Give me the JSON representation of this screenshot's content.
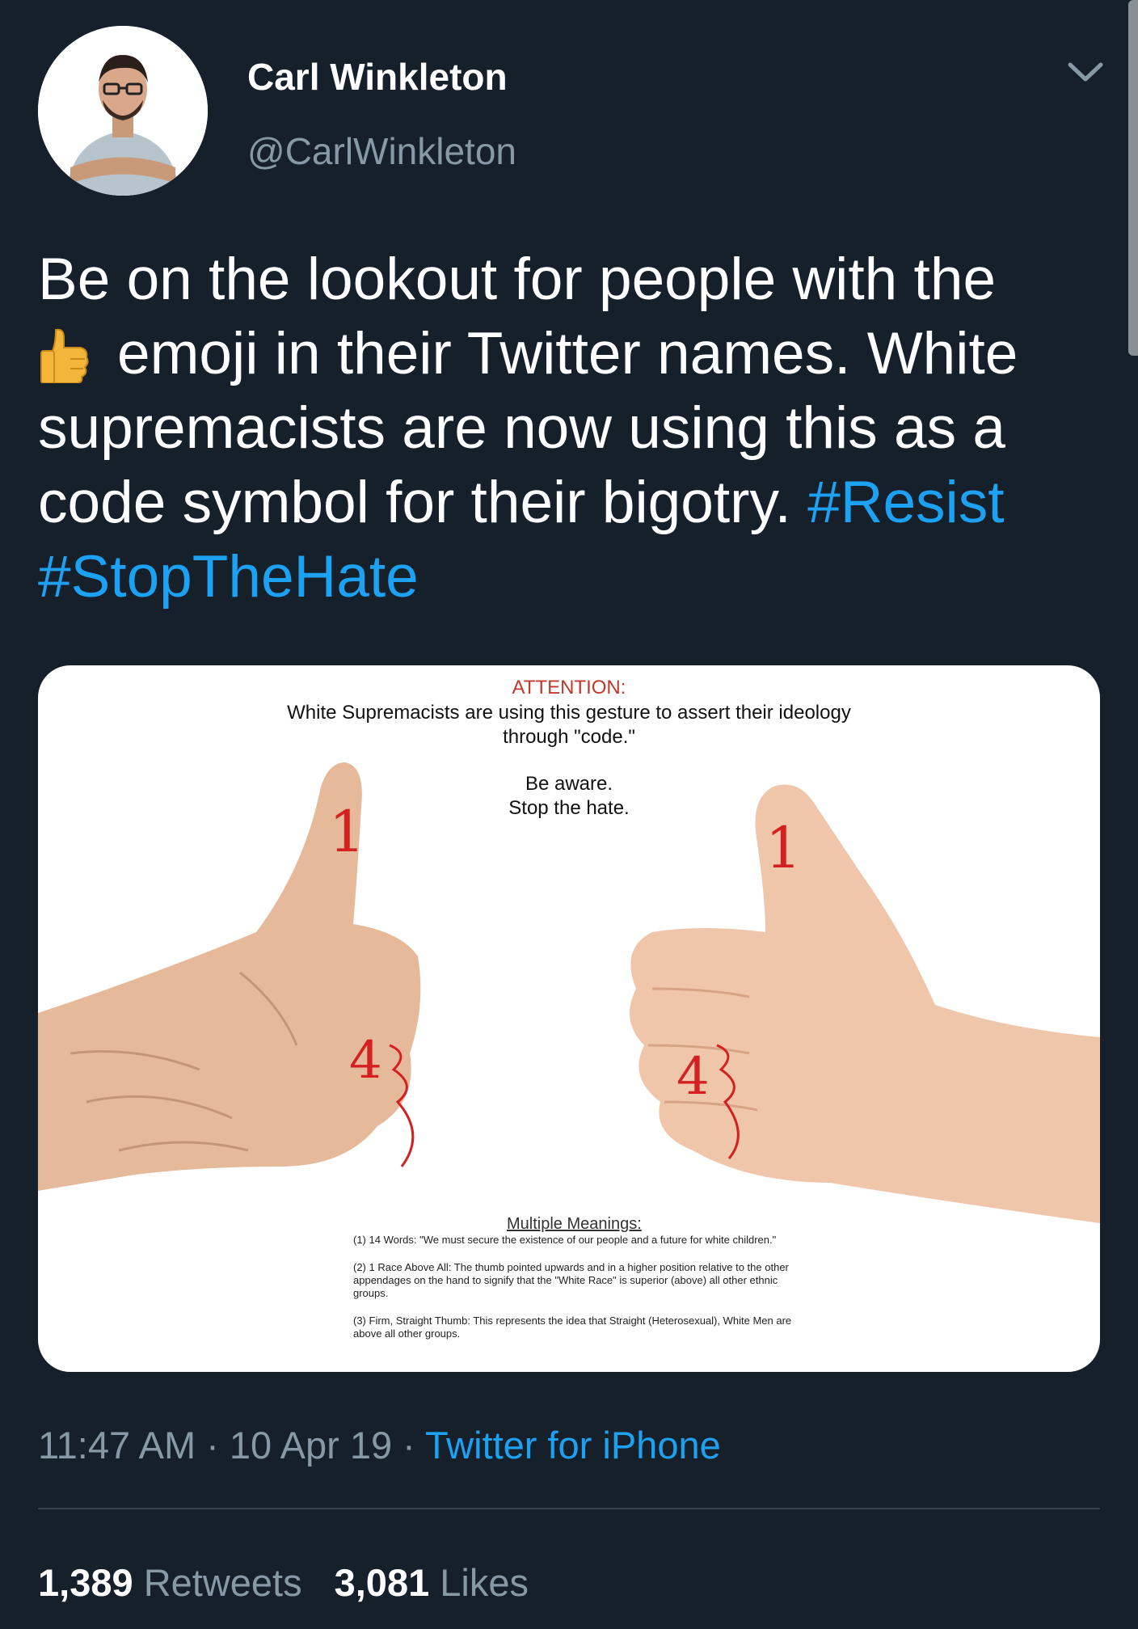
{
  "user": {
    "display_name": "Carl Winkleton",
    "handle": "@CarlWinkleton"
  },
  "tweet": {
    "line1": "Be on the lookout for people with the",
    "line2": "emoji in their Twitter names. White",
    "line3": "supremacists are now using this as a",
    "line4": "code symbol for their bigotry.",
    "hashtag1": "#Resist",
    "hashtag2": "#StopTheHate",
    "emoji": "thumbs-up-icon"
  },
  "media": {
    "attention_title": "ATTENTION:",
    "attention_sub": "White Supremacists are using this gesture to assert their ideology through \"code.\"",
    "aware_line1": "Be aware.",
    "aware_line2": "Stop the hate.",
    "meanings_title": "Multiple Meanings:",
    "meaning1": "(1) 14 Words: \"We must secure the existence of our people and a future for white children.\"",
    "meaning2": "(2) 1 Race Above All: The thumb pointed upwards and in a higher position relative to the other appendages on the hand to signify that the \"White Race\" is superior (above) all other ethnic groups.",
    "meaning3": "(3) Firm, Straight Thumb: This represents the idea that Straight (Heterosexual), White Men are above all other groups.",
    "mark_1": "1",
    "mark_4": "4"
  },
  "meta": {
    "time": "11:47 AM",
    "sep1": " · ",
    "date": "10 Apr 19",
    "sep2": " · ",
    "source": "Twitter for iPhone"
  },
  "stats": {
    "retweets_count": "1,389",
    "retweets_label": "Retweets",
    "likes_count": "3,081",
    "likes_label": "Likes"
  },
  "colors": {
    "background": "#15202b",
    "link": "#1da1f2",
    "muted": "#8899a6"
  }
}
